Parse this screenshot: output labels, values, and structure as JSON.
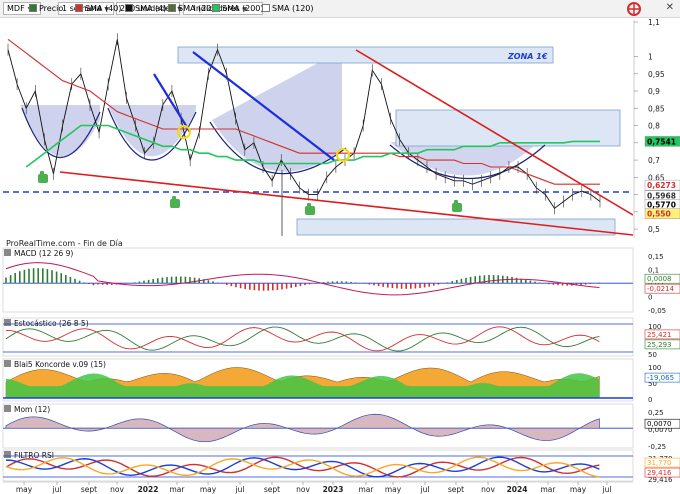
{
  "toolbar": {
    "symbol": "MDF",
    "period": "1 semana",
    "units": "200 unidades",
    "indicators": "Indicadores",
    "legend": [
      {
        "label": "Precio",
        "color": "#2e7d32"
      },
      {
        "label": "SMA (40)",
        "color": "#d32f2f"
      },
      {
        "label": "SMA (4)",
        "color": "#111111"
      },
      {
        "label": "SMA (20)",
        "color": "#556b2f"
      },
      {
        "label": "SMA (200)",
        "color": "#22c55e"
      },
      {
        "label": "SMA (120)",
        "color": "#ffffff"
      }
    ]
  },
  "main": {
    "watermark": "ProRealTime.com - Fin de Día",
    "zone_label": "ZONA 1€",
    "price_axis": [
      "1,1",
      "1",
      "0,95",
      "0,9",
      "0,85",
      "0,8",
      "0,75",
      "0,7",
      "0,65",
      "0,6",
      "0,55",
      "0,5"
    ],
    "price_tags": [
      {
        "text": "0,7541",
        "color": "#22c55e",
        "text_color": "#000000",
        "price": 0.7541
      },
      {
        "text": "0,6273",
        "color": "#ffffff",
        "text_color": "#d32f2f",
        "price": 0.6273
      },
      {
        "text": "0,5968",
        "color": "#ffffff",
        "text_color": "#333333",
        "price": 0.5968
      },
      {
        "text": "0,5770",
        "color": "#ffffff",
        "text_color": "#000000",
        "price": 0.577
      },
      {
        "text": "0,550",
        "color": "#fff176",
        "text_color": "#d32f2f",
        "price": 0.55
      }
    ]
  },
  "panels": {
    "macd": {
      "title": "MACD (12 26 9)",
      "axis": [
        "0,15",
        "0,1",
        "0,05",
        "0",
        "-0,05"
      ],
      "tags": [
        {
          "text": "0,0008",
          "color": "#2e7d32"
        },
        {
          "text": "-0,0214",
          "color": "#d32f2f"
        }
      ]
    },
    "stoch": {
      "title": "Estocástico (26 8 5)",
      "axis": [
        "100",
        "50"
      ],
      "tags": [
        {
          "text": "25,421",
          "color": "#d32f2f"
        },
        {
          "text": "25,293",
          "color": "#2e7d32"
        }
      ]
    },
    "blai5": {
      "title": "Blai5 Koncorde v.09 (15)",
      "axis": [
        "100",
        "50",
        "0"
      ],
      "tags": [
        {
          "text": "-19,065",
          "color": "#1565c0"
        }
      ]
    },
    "mom": {
      "title": "Mom (12)",
      "axis": [
        "0,25",
        "0,0070",
        "-0,25"
      ],
      "tags": [
        {
          "text": "0,0070",
          "color": "#000000"
        }
      ]
    },
    "rsi": {
      "title": "FILTRO RSI",
      "axis": [
        "31,770",
        "29,416"
      ],
      "tags": [
        {
          "text": "31,770",
          "color": "#f9a825"
        },
        {
          "text": "29,416",
          "color": "#d32f2f"
        }
      ]
    }
  },
  "time_axis": [
    "may",
    "jul",
    "sept",
    "nov",
    "2022",
    "mar",
    "may",
    "jul",
    "sept",
    "nov",
    "2023",
    "mar",
    "may",
    "jul",
    "sept",
    "nov",
    "2024",
    "mar",
    "may",
    "jul"
  ],
  "chart_data": {
    "type": "line",
    "title": "",
    "y_range": [
      0.48,
      1.1
    ],
    "series": [
      {
        "name": "Precio",
        "values": [
          1.02,
          0.92,
          0.85,
          0.9,
          0.76,
          0.66,
          0.8,
          0.92,
          0.95,
          0.86,
          0.78,
          0.92,
          1.05,
          0.88,
          0.8,
          0.72,
          0.75,
          0.86,
          0.9,
          0.82,
          0.7,
          0.78,
          0.95,
          1.02,
          0.95,
          0.82,
          0.73,
          0.75,
          0.68,
          0.64,
          0.7,
          0.66,
          0.62,
          0.6,
          0.6,
          0.65,
          0.68,
          0.7,
          0.72,
          0.8,
          0.96,
          0.92,
          0.82,
          0.76,
          0.72,
          0.7,
          0.68,
          0.66,
          0.65,
          0.64,
          0.64,
          0.63,
          0.64,
          0.65,
          0.66,
          0.68,
          0.68,
          0.66,
          0.62,
          0.6,
          0.56,
          0.58,
          0.6,
          0.61,
          0.6,
          0.58
        ]
      },
      {
        "name": "SMA (40)",
        "values": [
          1.05,
          1.03,
          1.01,
          0.99,
          0.97,
          0.95,
          0.93,
          0.92,
          0.91,
          0.9,
          0.88,
          0.86,
          0.84,
          0.83,
          0.82,
          0.81,
          0.8,
          0.79,
          0.79,
          0.79,
          0.79,
          0.79,
          0.79,
          0.79,
          0.79,
          0.79,
          0.78,
          0.77,
          0.76,
          0.75,
          0.74,
          0.73,
          0.72,
          0.72,
          0.72,
          0.72,
          0.72,
          0.72,
          0.72,
          0.72,
          0.72,
          0.72,
          0.72,
          0.71,
          0.71,
          0.71,
          0.7,
          0.7,
          0.7,
          0.7,
          0.69,
          0.69,
          0.69,
          0.68,
          0.68,
          0.68,
          0.67,
          0.66,
          0.65,
          0.64,
          0.63,
          0.63,
          0.63,
          0.63,
          0.63,
          0.63
        ]
      },
      {
        "name": "SMA (200)",
        "values": [
          null,
          null,
          0.68,
          0.7,
          0.72,
          0.74,
          0.76,
          0.78,
          0.8,
          0.8,
          0.8,
          0.8,
          0.79,
          0.78,
          0.77,
          0.76,
          0.75,
          0.74,
          0.74,
          0.73,
          0.73,
          0.72,
          0.72,
          0.71,
          0.71,
          0.7,
          0.7,
          0.7,
          0.69,
          0.69,
          0.69,
          0.69,
          0.69,
          0.69,
          0.69,
          0.69,
          0.7,
          0.7,
          0.7,
          0.71,
          0.71,
          0.71,
          0.72,
          0.72,
          0.72,
          0.72,
          0.73,
          0.73,
          0.73,
          0.73,
          0.74,
          0.74,
          0.74,
          0.74,
          0.75,
          0.75,
          0.75,
          0.75,
          0.75,
          0.75,
          0.75,
          0.75,
          0.754,
          0.754,
          0.754,
          0.754
        ]
      }
    ]
  }
}
